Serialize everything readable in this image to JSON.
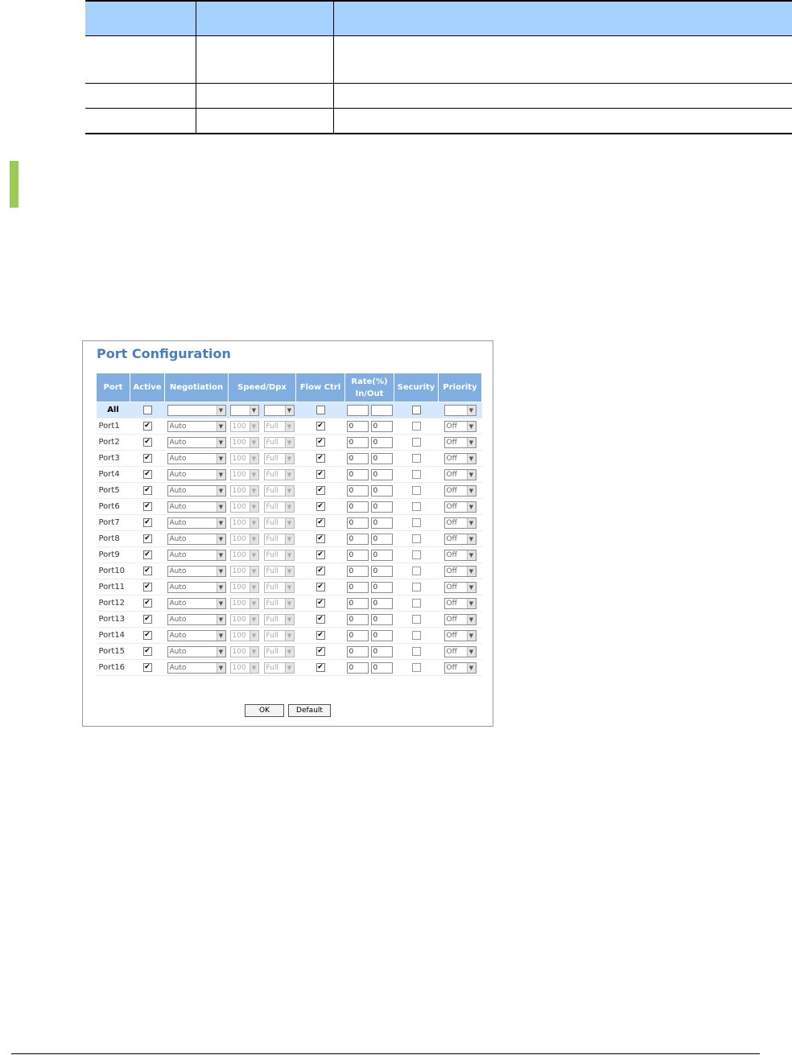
{
  "panel": {
    "title": "Port Configuration",
    "columns": [
      "Port",
      "Active",
      "Negotiation",
      "Speed/Dpx",
      "Flow Ctrl",
      "Rate(%)",
      "In/Out",
      "Security",
      "Priority"
    ],
    "all_row": {
      "port": "All"
    },
    "defaults": {
      "negotiation": "Auto",
      "speed": "100",
      "duplex": "Full",
      "rate_in": "0",
      "rate_out": "0",
      "priority": "Off"
    },
    "ports": [
      {
        "port": "Port1",
        "active": true,
        "flow_ctrl": true,
        "security": false
      },
      {
        "port": "Port2",
        "active": true,
        "flow_ctrl": true,
        "security": false
      },
      {
        "port": "Port3",
        "active": true,
        "flow_ctrl": true,
        "security": false
      },
      {
        "port": "Port4",
        "active": true,
        "flow_ctrl": true,
        "security": false
      },
      {
        "port": "Port5",
        "active": true,
        "flow_ctrl": true,
        "security": false
      },
      {
        "port": "Port6",
        "active": true,
        "flow_ctrl": true,
        "security": false
      },
      {
        "port": "Port7",
        "active": true,
        "flow_ctrl": true,
        "security": false
      },
      {
        "port": "Port8",
        "active": true,
        "flow_ctrl": true,
        "security": false
      },
      {
        "port": "Port9",
        "active": true,
        "flow_ctrl": true,
        "security": false
      },
      {
        "port": "Port10",
        "active": true,
        "flow_ctrl": true,
        "security": false
      },
      {
        "port": "Port11",
        "active": true,
        "flow_ctrl": true,
        "security": false
      },
      {
        "port": "Port12",
        "active": true,
        "flow_ctrl": true,
        "security": false
      },
      {
        "port": "Port13",
        "active": true,
        "flow_ctrl": true,
        "security": false
      },
      {
        "port": "Port14",
        "active": true,
        "flow_ctrl": true,
        "security": false
      },
      {
        "port": "Port15",
        "active": true,
        "flow_ctrl": true,
        "security": false
      },
      {
        "port": "Port16",
        "active": true,
        "flow_ctrl": true,
        "security": false
      }
    ],
    "buttons": {
      "ok": "OK",
      "default": "Default"
    }
  },
  "colors": {
    "spec_header": "#a6d2ff",
    "accent_bar": "#99cc55",
    "title": "#4a7ec3",
    "table_header": "#80aee0",
    "all_row": "#d6e8fb"
  }
}
